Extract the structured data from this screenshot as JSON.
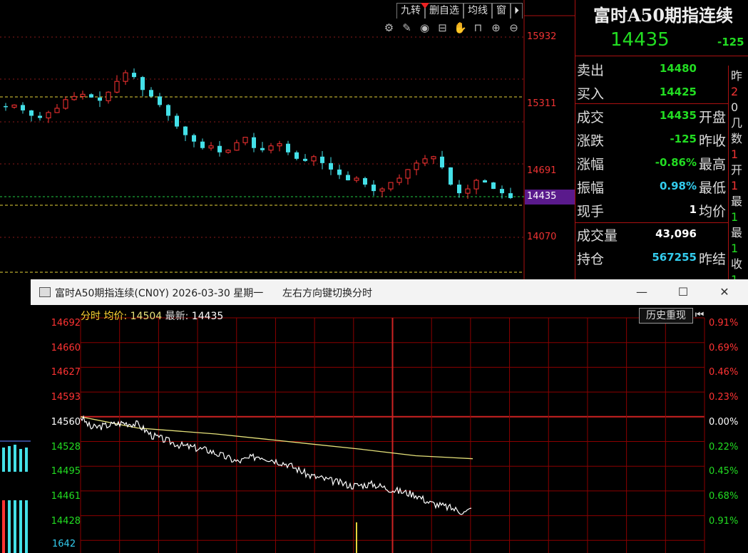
{
  "toolbar": {
    "tabs": [
      "九转",
      "删自选",
      "均线",
      "窗"
    ],
    "icons": [
      "gear-icon",
      "pen-icon",
      "eye-icon",
      "lock-open-icon",
      "hand-icon",
      "lock-icon",
      "zoom-in-icon",
      "zoom-out-icon"
    ],
    "collapse_glyph": "⏵"
  },
  "main_chart": {
    "price_labels": [
      "15932",
      "15311",
      "14691",
      "14435",
      "14070"
    ],
    "current_price_label": "14435",
    "colors": {
      "up": "#ff3333",
      "down": "#44e0e8",
      "dashed": "#e6d33a",
      "highlight_bg": "#5a1a8c"
    }
  },
  "quote": {
    "name": "富时A50期指连续",
    "last": "14435",
    "change": "-125",
    "rows": [
      {
        "label": "卖出",
        "value": "14480",
        "value_color": "#22dd22",
        "extra": ""
      },
      {
        "label": "买入",
        "value": "14425",
        "value_color": "#22dd22",
        "extra": ""
      },
      {
        "label": "成交",
        "value": "14435",
        "value_color": "#22dd22",
        "extra": "开盘"
      },
      {
        "label": "涨跌",
        "value": "-125",
        "value_color": "#22dd22",
        "extra": "昨收"
      },
      {
        "label": "涨幅",
        "value": "-0.86%",
        "value_color": "#22dd22",
        "extra": "最高"
      },
      {
        "label": "振幅",
        "value": "0.98%",
        "value_color": "#33ccee",
        "extra": "最低"
      },
      {
        "label": "现手",
        "value": "1",
        "value_color": "#ffffff",
        "extra": "均价"
      },
      {
        "label": "成交量",
        "value": "43,096",
        "value_color": "#ffffff",
        "extra": ""
      },
      {
        "label": "持仓",
        "value": "567255",
        "value_color": "#33ccee",
        "extra": "昨结"
      }
    ],
    "side_fragments": [
      "昨",
      "2",
      "0",
      "几",
      "数",
      "1",
      "开",
      "1",
      "最",
      "1",
      "最",
      "1",
      "收",
      "1"
    ]
  },
  "popup": {
    "title": "富时A50期指连续(CN0Y) 2026-03-30 星期一      左右方向键切换分时",
    "header_label": "分时",
    "avg_label": "均价:",
    "avg_value": "14504",
    "latest_label": "最新:",
    "latest_value": "14435",
    "history_button": "历史重现",
    "y_left": [
      "14692",
      "14660",
      "14627",
      "14593",
      "14560",
      "14528",
      "14495",
      "14461",
      "14428"
    ],
    "y_left_colors": [
      "#ff3333",
      "#ff3333",
      "#ff3333",
      "#ff3333",
      "#ffffff",
      "#22dd22",
      "#22dd22",
      "#22dd22",
      "#22dd22"
    ],
    "y_right": [
      "0.91%",
      "0.69%",
      "0.46%",
      "0.23%",
      "0.00%",
      "0.22%",
      "0.45%",
      "0.68%",
      "0.91%"
    ],
    "y_right_colors": [
      "#ff3333",
      "#ff3333",
      "#ff3333",
      "#ff3333",
      "#ffffff",
      "#22dd22",
      "#22dd22",
      "#22dd22",
      "#22dd22"
    ],
    "volume_label": "1642",
    "colors": {
      "grid": "#8b0000",
      "price_line": "#ffffff",
      "avg_line": "#e6e27a"
    }
  }
}
